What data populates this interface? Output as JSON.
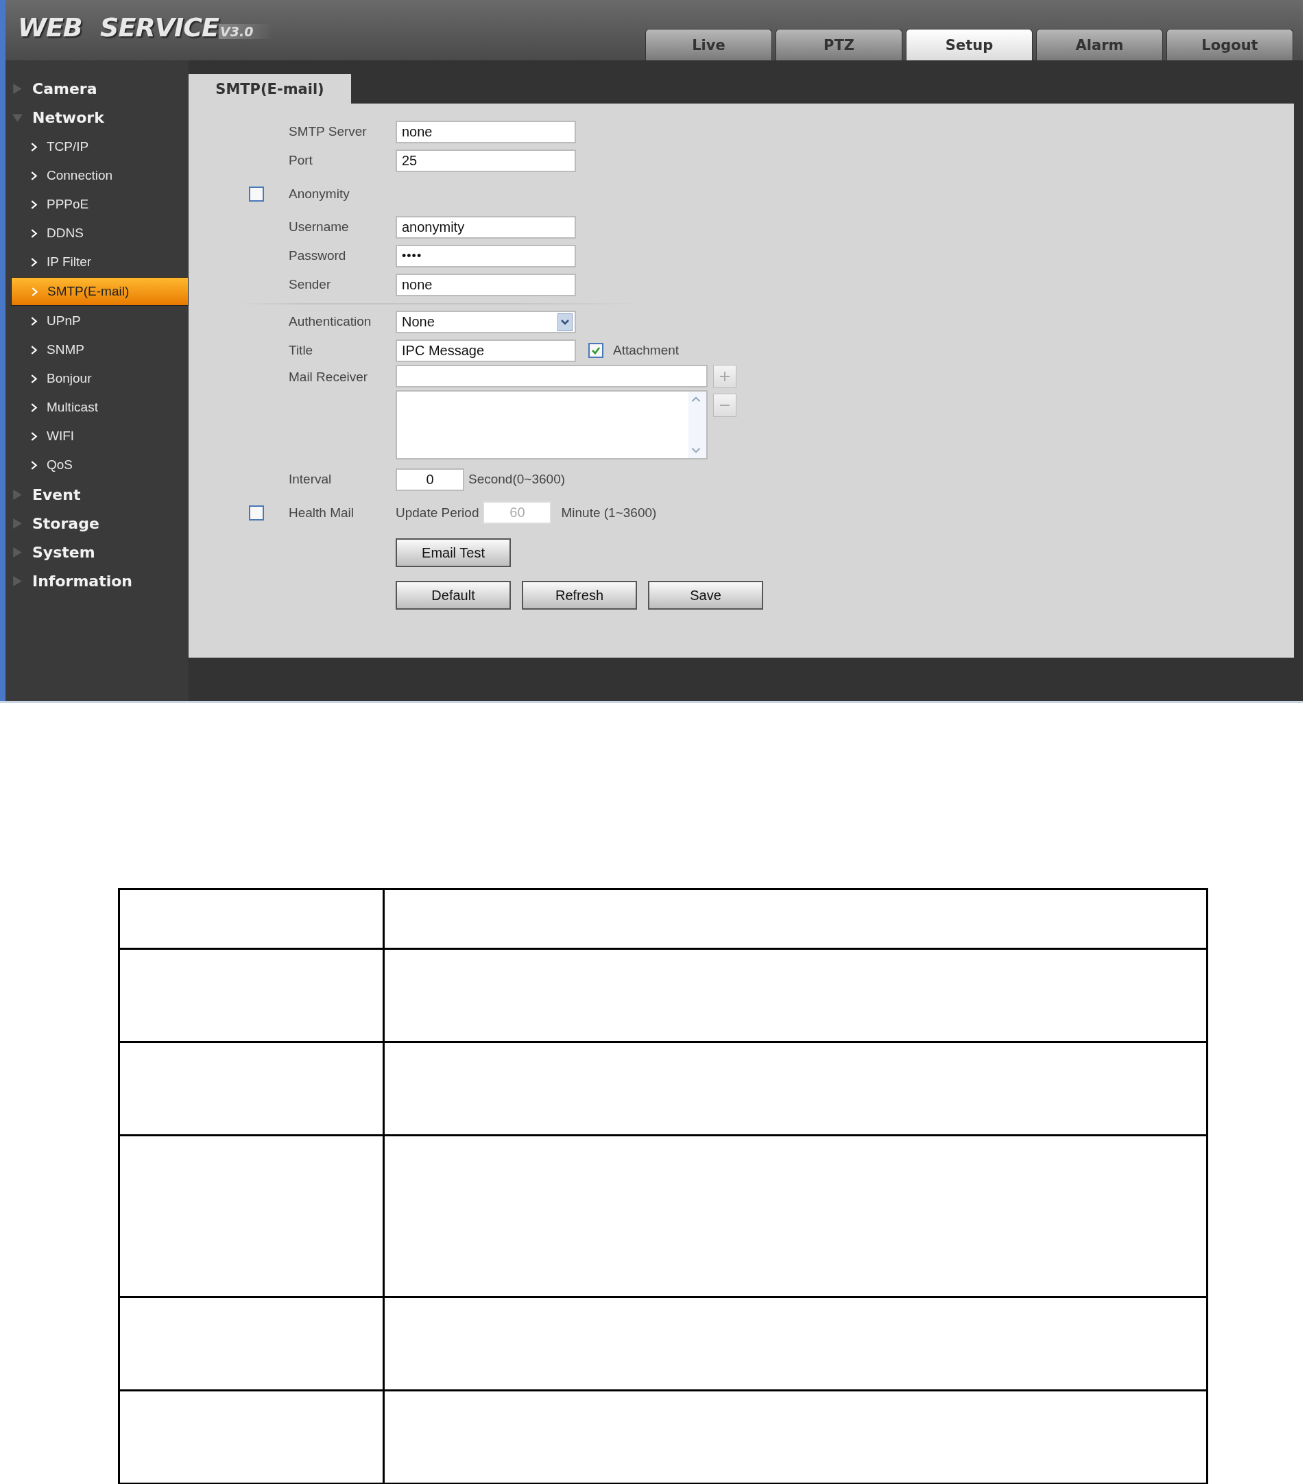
{
  "header": {
    "logo": "WEB SERVICE",
    "version": "V3.0"
  },
  "tabs": [
    {
      "label": "Live",
      "selected": false
    },
    {
      "label": "PTZ",
      "selected": false
    },
    {
      "label": "Setup",
      "selected": true
    },
    {
      "label": "Alarm",
      "selected": false
    },
    {
      "label": "Logout",
      "selected": false
    }
  ],
  "sidebar": {
    "items": [
      {
        "label": "Camera",
        "expanded": false
      },
      {
        "label": "Network",
        "expanded": true,
        "children": [
          {
            "label": "TCP/IP",
            "selected": false
          },
          {
            "label": "Connection",
            "selected": false
          },
          {
            "label": "PPPoE",
            "selected": false
          },
          {
            "label": "DDNS",
            "selected": false
          },
          {
            "label": "IP Filter",
            "selected": false
          },
          {
            "label": "SMTP(E-mail)",
            "selected": true
          },
          {
            "label": "UPnP",
            "selected": false
          },
          {
            "label": "SNMP",
            "selected": false
          },
          {
            "label": "Bonjour",
            "selected": false
          },
          {
            "label": "Multicast",
            "selected": false
          },
          {
            "label": "WIFI",
            "selected": false
          },
          {
            "label": "QoS",
            "selected": false
          }
        ]
      },
      {
        "label": "Event",
        "expanded": false
      },
      {
        "label": "Storage",
        "expanded": false
      },
      {
        "label": "System",
        "expanded": false
      },
      {
        "label": "Information",
        "expanded": false
      }
    ]
  },
  "panel": {
    "tab": "SMTP(E-mail)",
    "smtp_server": {
      "label": "SMTP Server",
      "value": "none"
    },
    "port": {
      "label": "Port",
      "value": "25"
    },
    "anonymity": {
      "label": "Anonymity",
      "checked": false
    },
    "username": {
      "label": "Username",
      "value": "anonymity"
    },
    "password": {
      "label": "Password",
      "value": "••••"
    },
    "sender": {
      "label": "Sender",
      "value": "none"
    },
    "authentication": {
      "label": "Authentication",
      "value": "None"
    },
    "title": {
      "label": "Title",
      "value": "IPC Message"
    },
    "attachment": {
      "label": "Attachment",
      "checked": true
    },
    "mail_receiver": {
      "label": "Mail Receiver"
    },
    "interval": {
      "label": "Interval",
      "value": "0",
      "unit": "Second(0~3600)"
    },
    "health_mail": {
      "label": "Health Mail",
      "checked": false,
      "period_label": "Update Period",
      "period_value": "60",
      "unit": "Minute (1~3600)",
      "disabled": true
    },
    "email_test": "Email Test",
    "buttons": [
      "Default",
      "Refresh",
      "Save"
    ]
  }
}
